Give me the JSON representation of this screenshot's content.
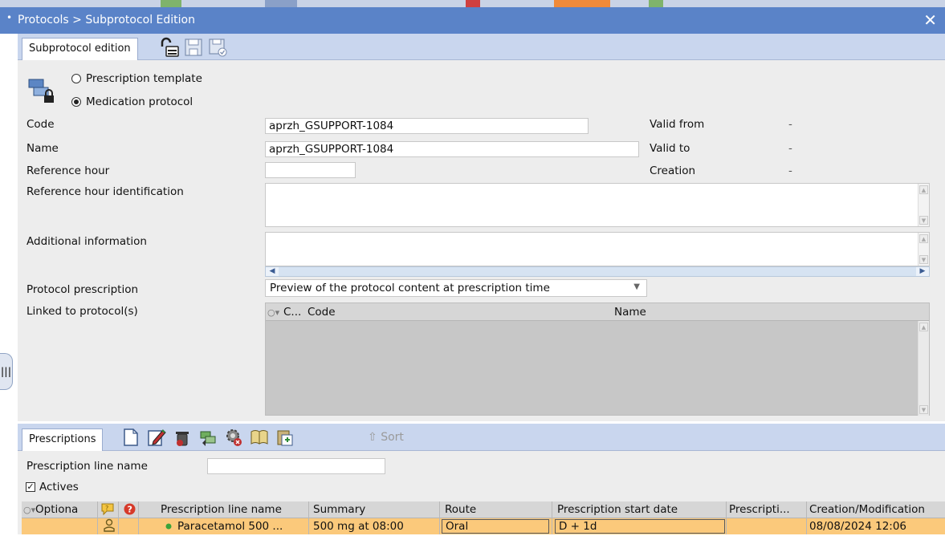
{
  "window": {
    "title": "Protocols > Subprotocol Edition",
    "close_glyph": "✕"
  },
  "toolbar": {
    "tab_label": "Subprotocol edition",
    "icons": [
      "unlock-icon",
      "save-icon",
      "save-validate-icon"
    ]
  },
  "form": {
    "type_options": [
      {
        "label": "Prescription template",
        "selected": false
      },
      {
        "label": "Medication protocol",
        "selected": true
      }
    ],
    "code_label": "Code",
    "code_value": "aprzh_GSUPPORT-1084",
    "name_label": "Name",
    "name_value": "aprzh_GSUPPORT-1084",
    "ref_hour_label": "Reference hour",
    "ref_hour_value": "",
    "ref_hour_id_label": "Reference hour identification",
    "ref_hour_id_value": "",
    "additional_label": "Additional information",
    "additional_value": "",
    "valid_from_label": "Valid from",
    "valid_from_value": "-",
    "valid_to_label": "Valid to",
    "valid_to_value": "-",
    "creation_label": "Creation",
    "creation_value": "-",
    "protocol_prescription_label": "Protocol prescription",
    "protocol_prescription_value": "Preview of the protocol content at prescription time",
    "linked_label": "Linked to protocol(s)",
    "linked_columns": [
      "C...",
      "Code",
      "Name"
    ]
  },
  "prescriptions": {
    "tab_label": "Prescriptions",
    "icons": [
      "new-document-icon",
      "edit-icon",
      "delete-icon",
      "copy-icon",
      "settings-remove-icon",
      "book-icon",
      "paste-icon"
    ],
    "sort_label": "Sort",
    "filter_label": "Prescription line name",
    "filter_value": "",
    "actives_label": "Actives",
    "actives_checked": true,
    "columns": [
      "Optiona",
      "Prescription line name",
      "Summary",
      "Route",
      "Prescription start date",
      "Prescripti...",
      "Creation/Modification"
    ],
    "rows": [
      {
        "prescription_line_name": "Paracetamol 500 ...",
        "summary": "500 mg at 08:00",
        "route": "Oral",
        "start_date": "D + 1d",
        "prescriptive": "",
        "created": "08/08/2024 12:06"
      }
    ]
  },
  "colors": {
    "title_bar": "#5a83c8",
    "toolbar": "#c9d6ee",
    "panel": "#ededed",
    "selected_row": "#fbc97b"
  }
}
